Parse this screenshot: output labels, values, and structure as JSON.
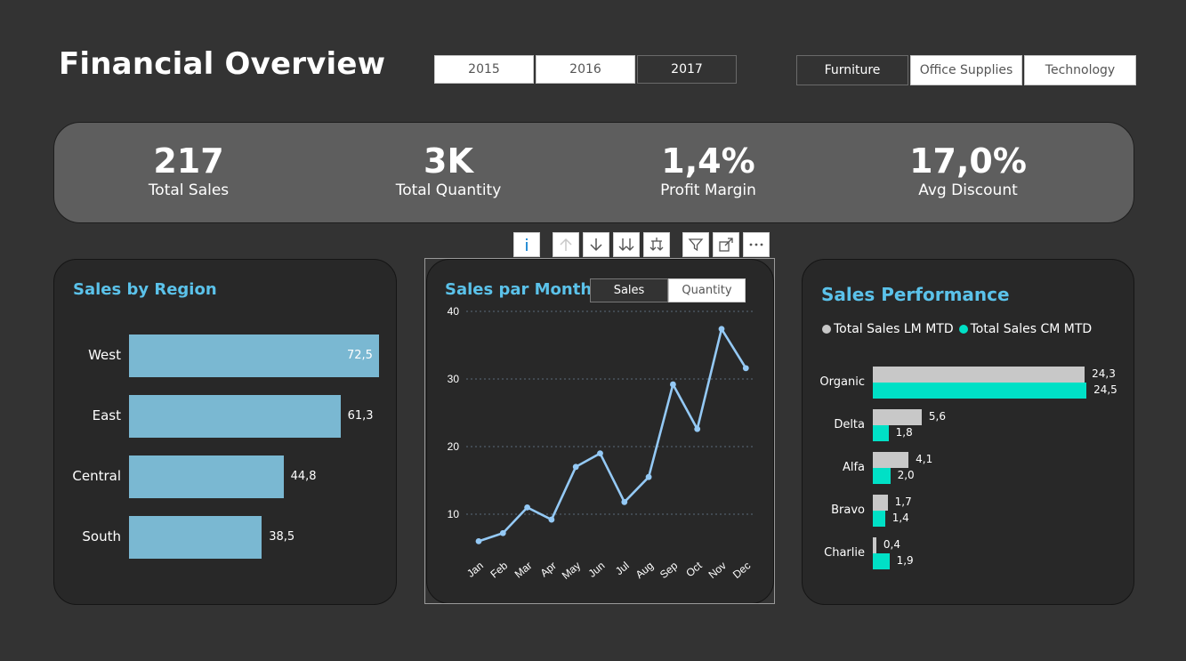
{
  "title": "Financial Overview",
  "year_slicer": [
    {
      "label": "2015",
      "selected": true
    },
    {
      "label": "2016",
      "selected": true
    },
    {
      "label": "2017",
      "selected": false
    }
  ],
  "category_slicer": [
    {
      "label": "Furniture",
      "selected": false
    },
    {
      "label": "Office Supplies",
      "selected": true
    },
    {
      "label": "Technology",
      "selected": true
    }
  ],
  "kpis": [
    {
      "value": "217",
      "label": "Total Sales"
    },
    {
      "value": "3K",
      "label": "Total Quantity"
    },
    {
      "value": "1,4%",
      "label": "Profit Margin"
    },
    {
      "value": "17,0%",
      "label": "Avg Discount"
    }
  ],
  "visual_toolbar": [
    "info-icon",
    "drill-up-icon",
    "drill-down-icon",
    "expand-all-down-icon",
    "expand-hierarchy-icon",
    "filter-icon",
    "focus-mode-icon",
    "more-options-icon"
  ],
  "region_card": {
    "title": "Sales by Region"
  },
  "month_card": {
    "title": "Sales par Month",
    "toggle": [
      {
        "label": "Sales",
        "selected": false
      },
      {
        "label": "Quantity",
        "selected": true
      }
    ]
  },
  "perf_card": {
    "title": "Sales Performance",
    "legend": [
      {
        "label": "Total Sales LM MTD",
        "color": "#c8c8c8"
      },
      {
        "label": "Total Sales CM MTD",
        "color": "#00e0c6"
      }
    ]
  },
  "colors": {
    "accent": "#5bc2ea",
    "bar": "#7ab8d2",
    "line": "#94c9f5",
    "lm": "#c8c8c8",
    "cm": "#00e0c6"
  },
  "chart_data": [
    {
      "type": "bar",
      "orientation": "horizontal",
      "title": "Sales by Region",
      "categories": [
        "West",
        "East",
        "Central",
        "South"
      ],
      "values": [
        72.5,
        61.3,
        44.8,
        38.5
      ],
      "value_labels": [
        "72,5",
        "61,3",
        "44,8",
        "38,5"
      ]
    },
    {
      "type": "line",
      "title": "Sales par Month",
      "categories": [
        "Jan",
        "Feb",
        "Mar",
        "Apr",
        "May",
        "Jun",
        "Jul",
        "Aug",
        "Sep",
        "Oct",
        "Nov",
        "Dec"
      ],
      "values": [
        6,
        7.2,
        11,
        9.2,
        17,
        19,
        11.8,
        15.5,
        29.2,
        22.6,
        37.4,
        31.6
      ],
      "ylim": [
        0,
        40
      ],
      "yticks": [
        10,
        20,
        30,
        40
      ],
      "grid": true
    },
    {
      "type": "bar",
      "orientation": "horizontal",
      "title": "Sales Performance",
      "categories": [
        "Organic",
        "Delta",
        "Alfa",
        "Bravo",
        "Charlie"
      ],
      "series": [
        {
          "name": "Total Sales LM MTD",
          "values": [
            24.3,
            5.6,
            4.1,
            1.7,
            0.4
          ],
          "labels": [
            "24,3",
            "5,6",
            "4,1",
            "1,7",
            "0,4"
          ]
        },
        {
          "name": "Total Sales CM MTD",
          "values": [
            24.5,
            1.8,
            2.0,
            1.4,
            1.9
          ],
          "labels": [
            "24,5",
            "1,8",
            "2,0",
            "1,4",
            "1,9"
          ]
        }
      ],
      "legend": "top-left"
    }
  ]
}
